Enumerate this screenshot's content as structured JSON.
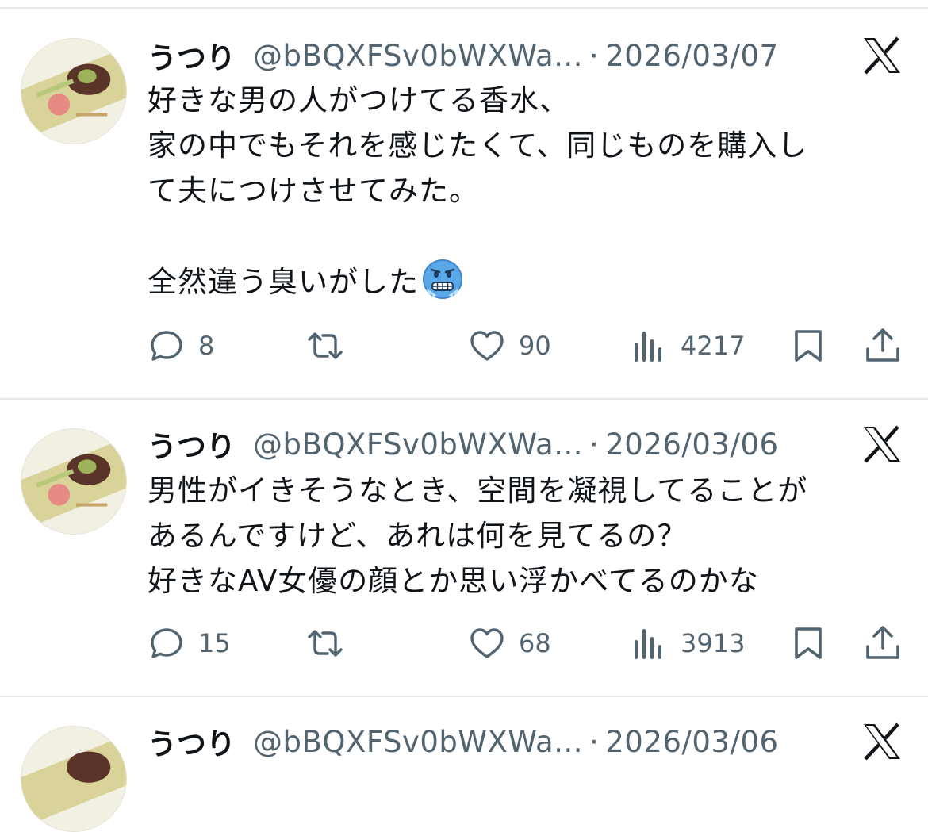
{
  "tweets": [
    {
      "name": "うつり",
      "handle": "@bBQXFSv0bWXWa...",
      "date": "2026/03/07",
      "text": "好きな男の人がつけてる香水、\n家の中でもそれを感じたくて、同じものを購入し\nて夫につけさせてみた。\n\n全然違う臭いがした",
      "emoji": "cold-face-emoji",
      "replies": "8",
      "likes": "90",
      "views": "4217"
    },
    {
      "name": "うつり",
      "handle": "@bBQXFSv0bWXWa...",
      "date": "2026/03/06",
      "text": "男性がイきそうなとき、空間を凝視してることが\nあるんですけど、あれは何を見てるの？\n好きなAV女優の顔とか思い浮かべてるのかな",
      "replies": "15",
      "likes": "68",
      "views": "3913"
    },
    {
      "name": "うつり",
      "handle": "@bBQXFSv0bWXWa...",
      "date": "2026/03/06"
    }
  ],
  "header": {
    "separator": "·"
  },
  "icons": {
    "reply": "reply-icon",
    "retweet": "retweet-icon",
    "like": "like-icon",
    "views": "views-icon",
    "bookmark": "bookmark-icon",
    "share": "share-icon",
    "platform": "x-logo-icon"
  },
  "colors": {
    "text": "#0f1419",
    "muted": "#536471",
    "divider": "#e6e9ec",
    "background": "#ffffff"
  }
}
